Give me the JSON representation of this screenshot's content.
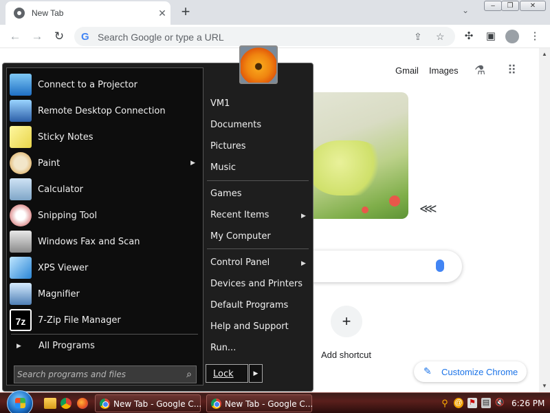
{
  "browser": {
    "tab_title": "New Tab",
    "omnibox_placeholder": "Search Google or type a URL",
    "header_links": [
      "Gmail",
      "Images"
    ],
    "shortcut_label": "Add shortcut",
    "customize_label": "Customize Chrome"
  },
  "start_menu": {
    "programs": [
      {
        "label": "Connect to a Projector",
        "icon": "projector-icon",
        "submenu": false
      },
      {
        "label": "Remote Desktop Connection",
        "icon": "remote-desktop-icon",
        "submenu": false
      },
      {
        "label": "Sticky Notes",
        "icon": "sticky-notes-icon",
        "submenu": false
      },
      {
        "label": "Paint",
        "icon": "paint-palette-icon",
        "submenu": true
      },
      {
        "label": "Calculator",
        "icon": "calculator-icon",
        "submenu": false
      },
      {
        "label": "Snipping Tool",
        "icon": "scissors-icon",
        "submenu": false
      },
      {
        "label": "Windows Fax and Scan",
        "icon": "fax-icon",
        "submenu": false
      },
      {
        "label": "XPS Viewer",
        "icon": "xps-icon",
        "submenu": false
      },
      {
        "label": "Magnifier",
        "icon": "magnifier-icon",
        "submenu": false
      },
      {
        "label": "7-Zip File Manager",
        "icon": "7zip-icon",
        "icon_text": "7z",
        "submenu": false
      }
    ],
    "all_programs": "All Programs",
    "search_placeholder": "Search programs and files",
    "right_links": [
      {
        "label": "VM1",
        "submenu": false
      },
      {
        "label": "Documents",
        "submenu": false
      },
      {
        "label": "Pictures",
        "submenu": false
      },
      {
        "label": "Music",
        "submenu": false
      },
      {
        "label": "Games",
        "submenu": false
      },
      {
        "label": "Recent Items",
        "submenu": true
      },
      {
        "label": "My Computer",
        "submenu": false
      },
      {
        "label": "Control Panel",
        "submenu": true
      },
      {
        "label": "Devices and Printers",
        "submenu": false
      },
      {
        "label": "Default Programs",
        "submenu": false
      },
      {
        "label": "Help and Support",
        "submenu": false
      },
      {
        "label": "Run...",
        "submenu": false
      }
    ],
    "power_button": "Lock"
  },
  "taskbar": {
    "buttons": [
      "New Tab - Google C...",
      "New Tab - Google C..."
    ],
    "clock": "6:26 PM"
  },
  "colors": {
    "accent": "#1a73e8",
    "start_menu_bg": "#1e1e1e",
    "taskbar": "#5a1f1c"
  }
}
